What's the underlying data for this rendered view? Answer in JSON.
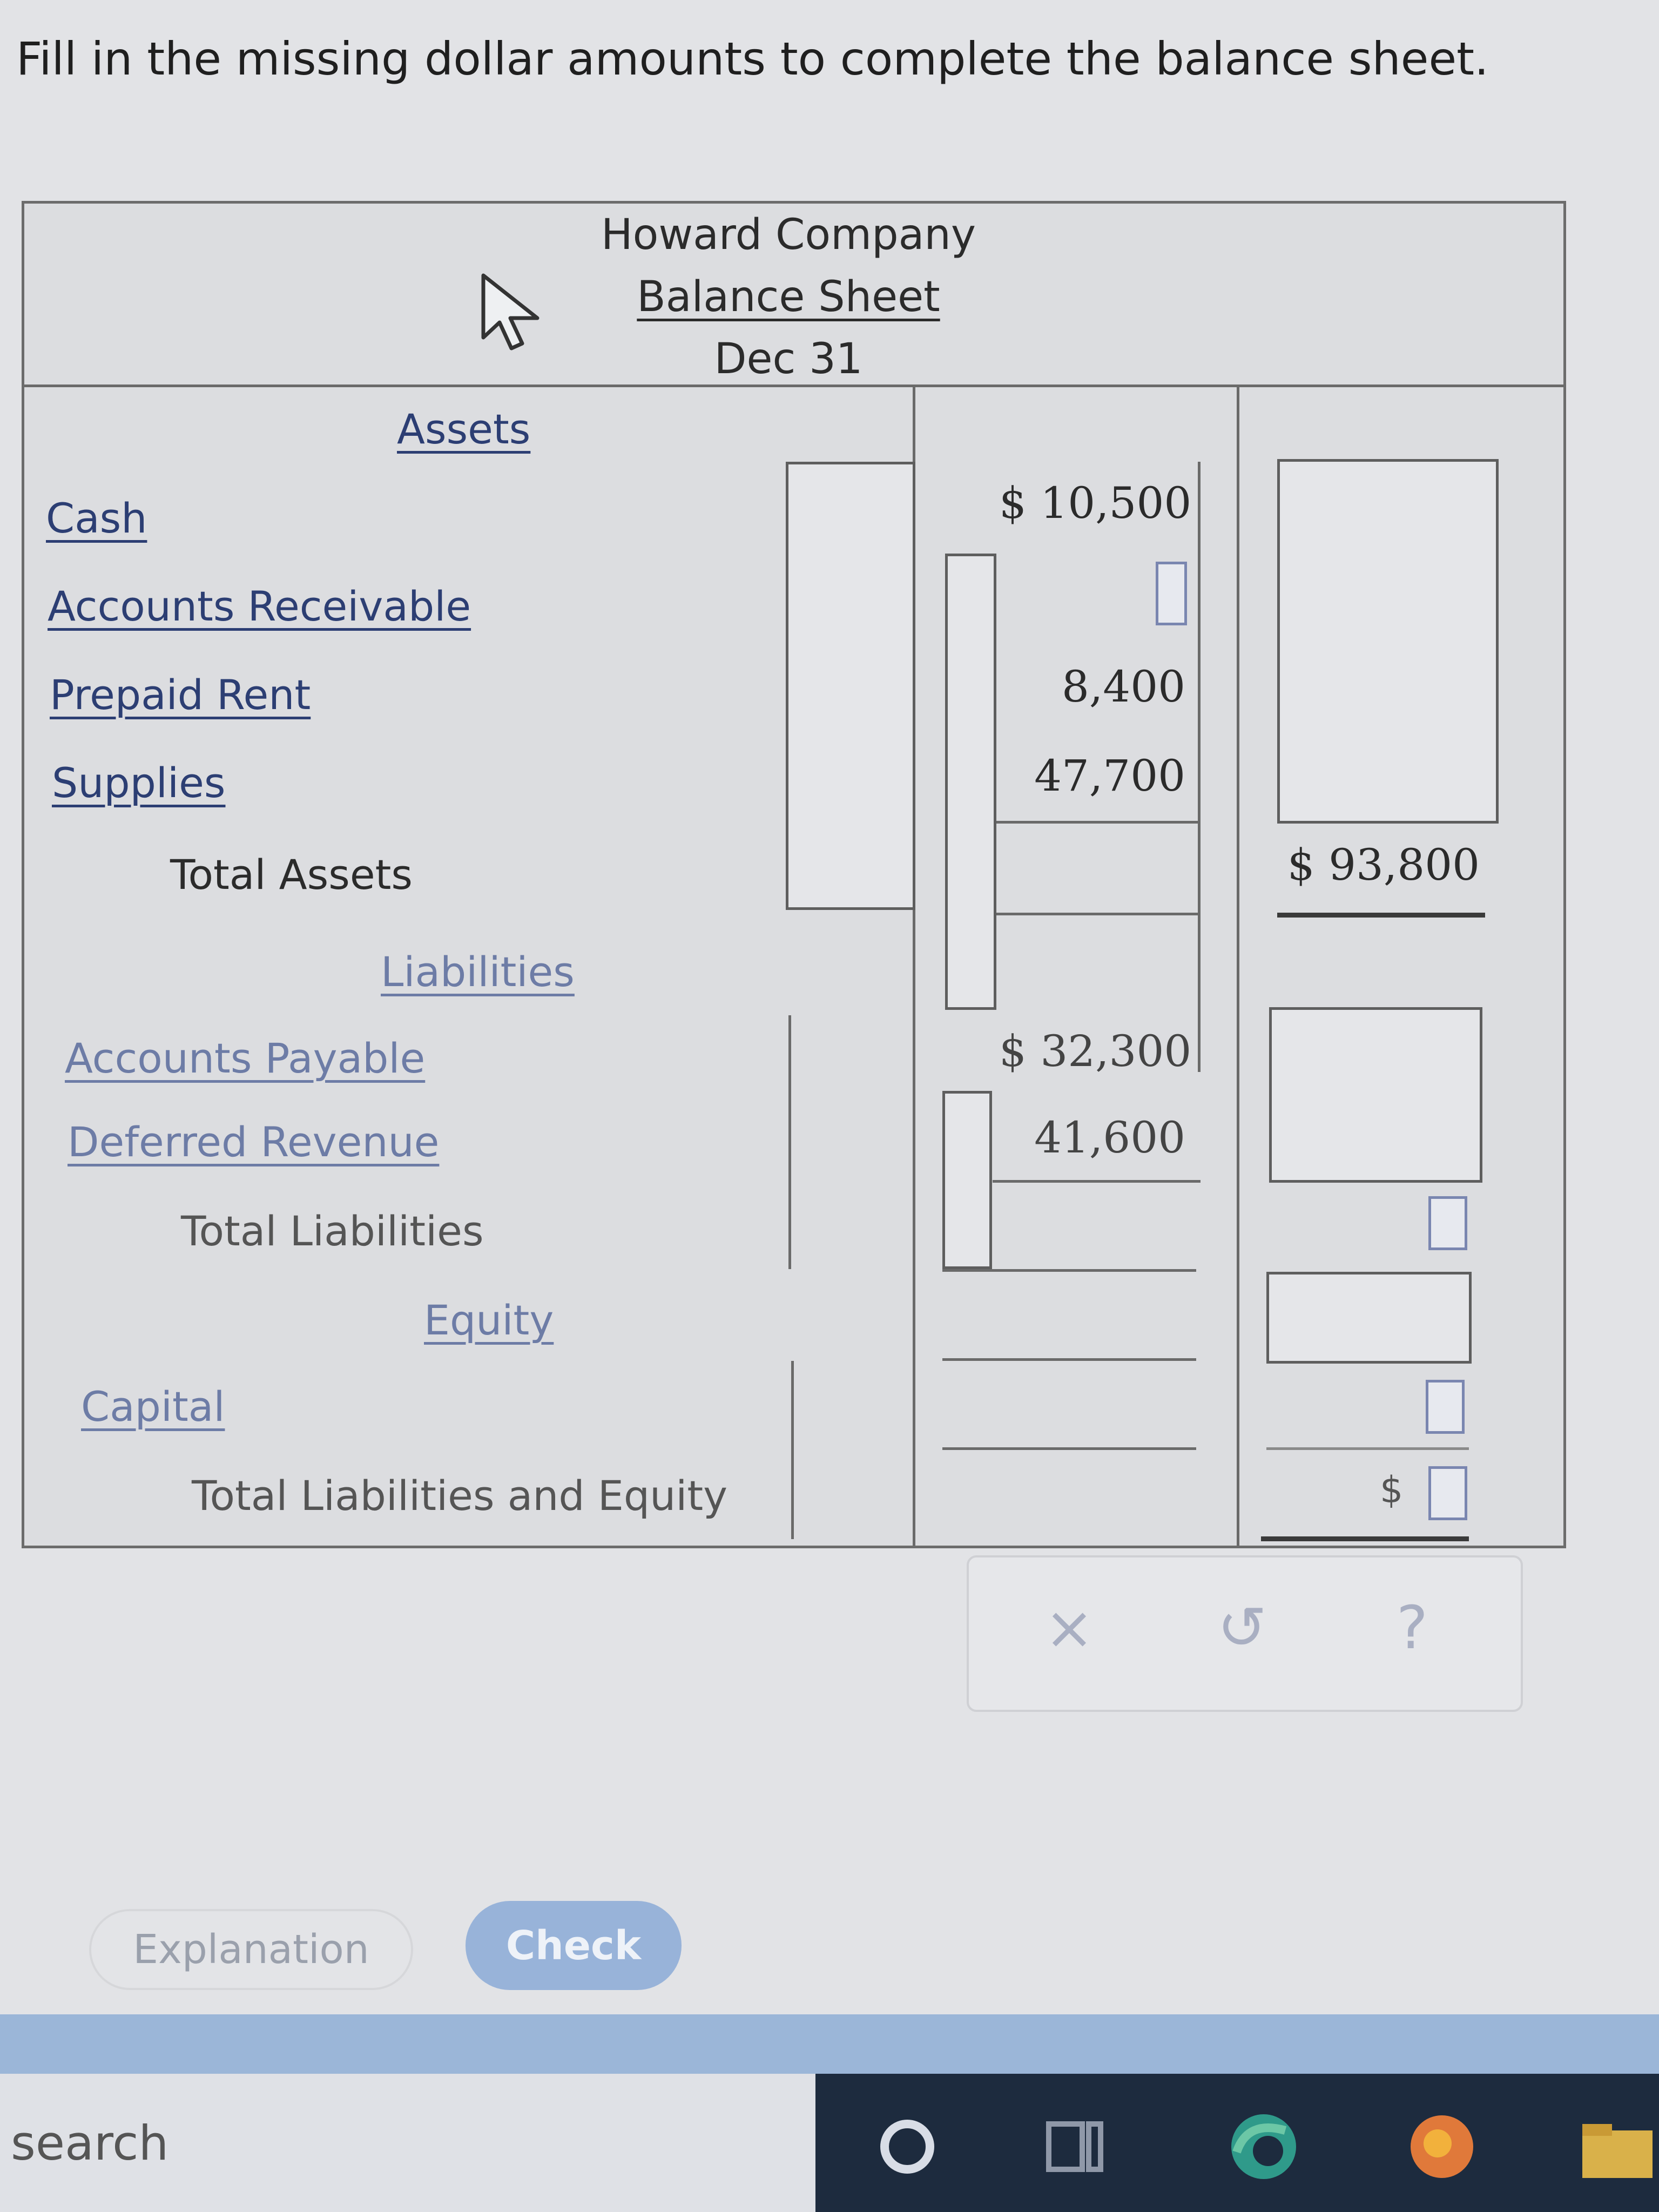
{
  "instruction": "Fill in the missing dollar amounts to complete the balance sheet.",
  "header": {
    "company": "Howard Company",
    "title": "Balance Sheet",
    "date": "Dec 31"
  },
  "sections": {
    "assets": "Assets",
    "liabilities": "Liabilities",
    "equity": "Equity"
  },
  "rows": {
    "cash": {
      "label": "Cash",
      "amount": "$ 10,500"
    },
    "accounts_receivable": {
      "label": "Accounts Receivable",
      "amount": ""
    },
    "prepaid_rent": {
      "label": "Prepaid Rent",
      "amount": "8,400"
    },
    "supplies": {
      "label": "Supplies",
      "amount": "47,700"
    },
    "total_assets": {
      "label": "Total Assets",
      "amount": "$ 93,800"
    },
    "accounts_payable": {
      "label": "Accounts Payable",
      "amount": "$ 32,300"
    },
    "deferred_revenue": {
      "label": "Deferred Revenue",
      "amount": "41,600"
    },
    "total_liabilities": {
      "label": "Total Liabilities",
      "amount": ""
    },
    "capital": {
      "label": "Capital",
      "amount": ""
    },
    "total_liabilities_equity": {
      "label": "Total Liabilities and Equity",
      "prefix": "$",
      "amount": ""
    }
  },
  "toolbar": {
    "clear": "×",
    "undo": "↺",
    "help": "?"
  },
  "buttons": {
    "explanation": "Explanation",
    "check": "Check"
  },
  "taskbar": {
    "search_placeholder": "search"
  },
  "colors": {
    "check_button": "#98b3d9",
    "taskbar": "#1d2b3e",
    "band": "#9bb6d8"
  }
}
